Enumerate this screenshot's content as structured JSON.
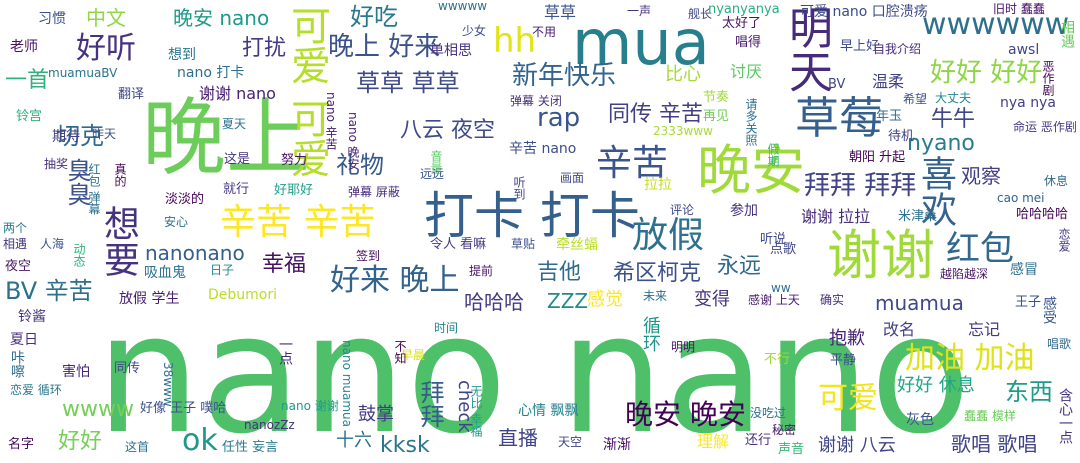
{
  "words": [
    {
      "text": "nano nano",
      "color": "#4fc06a"
    },
    {
      "text": "晚上",
      "color": "#6ccd5a"
    },
    {
      "text": "mua",
      "color": "#277f8e"
    },
    {
      "text": "谢谢",
      "color": "#a0da39"
    },
    {
      "text": "晚安",
      "color": "#a0da39"
    },
    {
      "text": "打卡 打卡",
      "color": "#355f8d"
    },
    {
      "text": "明天",
      "color": "#472a7a"
    },
    {
      "text": "草莓",
      "color": "#355f8d"
    },
    {
      "text": "可爱 可爱",
      "color": "#b5de2b"
    },
    {
      "text": "辛苦 辛苦",
      "color": "#fde725"
    },
    {
      "text": "放假",
      "color": "#2c728e"
    },
    {
      "text": "辛苦",
      "color": "#3a548c"
    },
    {
      "text": "想要",
      "color": "#46337f"
    },
    {
      "text": "喜欢",
      "color": "#33638d"
    },
    {
      "text": "红包",
      "color": "#31688e"
    },
    {
      "text": "好听",
      "color": "#46327e"
    },
    {
      "text": "wwwwww",
      "color": "#2e6f8e"
    },
    {
      "text": "hh",
      "color": "#e2e418"
    },
    {
      "text": "新年快乐",
      "color": "#32648e"
    },
    {
      "text": "加油 加油",
      "color": "#dde318"
    },
    {
      "text": "可爱",
      "color": "#f1e51d"
    },
    {
      "text": "晚安 晚安",
      "color": "#440154"
    },
    {
      "text": "好来 晚上",
      "color": "#33638d"
    },
    {
      "text": "拜拜 拜拜",
      "color": "#414487"
    },
    {
      "text": "好好 好好",
      "color": "#8ed645"
    },
    {
      "text": "草草 草草",
      "color": "#3e4989"
    },
    {
      "text": "晚上 好来",
      "color": "#3b528b"
    },
    {
      "text": "打扰",
      "color": "#443983"
    },
    {
      "text": "好吃",
      "color": "#2a788e"
    },
    {
      "text": "中文",
      "color": "#8fd744"
    },
    {
      "text": "晚安 nano",
      "color": "#1f9a8a"
    },
    {
      "text": "一首",
      "color": "#2db27d"
    },
    {
      "text": "切克",
      "color": "#31688e"
    },
    {
      "text": "臭臭",
      "color": "#3b528b"
    },
    {
      "text": "礼物",
      "color": "#375b8d"
    },
    {
      "text": "同传 辛苦",
      "color": "#433e85"
    },
    {
      "text": "rap",
      "color": "#39568c"
    },
    {
      "text": "八云 夜空",
      "color": "#3e4a89"
    },
    {
      "text": "牛牛",
      "color": "#3f4788"
    },
    {
      "text": "nyano",
      "color": "#297b8e"
    },
    {
      "text": "BV 辛苦",
      "color": "#2d708e"
    },
    {
      "text": "吉他",
      "color": "#2f6b8e"
    },
    {
      "text": "幸福",
      "color": "#471063"
    },
    {
      "text": "nanonano",
      "color": "#355e8d"
    },
    {
      "text": "希区柯克",
      "color": "#3b528b"
    },
    {
      "text": "永远",
      "color": "#31688e"
    },
    {
      "text": "muamua",
      "color": "#3f4889"
    },
    {
      "text": "ok",
      "color": "#1f988b"
    },
    {
      "text": "wwww",
      "color": "#73d056"
    },
    {
      "text": "直播",
      "color": "#404588"
    },
    {
      "text": "拜拜",
      "color": "#365c8d"
    },
    {
      "text": "东西",
      "color": "#1e9c89"
    },
    {
      "text": "好好 休息",
      "color": "#21a685"
    },
    {
      "text": "歌唱 歌唱",
      "color": "#414487"
    },
    {
      "text": "谢谢 八云",
      "color": "#3f4788"
    },
    {
      "text": "kksk",
      "color": "#2a768e"
    },
    {
      "text": "鼓掌",
      "color": "#443983"
    },
    {
      "text": "十六",
      "color": "#2c718e"
    },
    {
      "text": "好好",
      "color": "#75d054"
    },
    {
      "text": "哈哈哈",
      "color": "#443a83"
    },
    {
      "text": "ZZZ",
      "color": "#238a8d"
    },
    {
      "text": "感觉",
      "color": "#fde725"
    },
    {
      "text": "变得",
      "color": "#46337f"
    },
    {
      "text": "抱歉",
      "color": "#482576"
    },
    {
      "text": "改名",
      "color": "#424086"
    },
    {
      "text": "忘记",
      "color": "#453781"
    },
    {
      "text": "循环",
      "color": "#1f958b"
    },
    {
      "text": "check",
      "color": "#414487"
    },
    {
      "text": "理解",
      "color": "#fde725"
    },
    {
      "text": "比心",
      "color": "#a5db36"
    },
    {
      "text": "讨厌",
      "color": "#5cc863"
    },
    {
      "text": "谢谢 nano",
      "color": "#482173"
    },
    {
      "text": "谢谢 拉拉",
      "color": "#472d7b"
    },
    {
      "text": "观察",
      "color": "#433d84"
    },
    {
      "text": "温柔",
      "color": "#424186"
    },
    {
      "text": "nano 打卡",
      "color": "#2d708e"
    },
    {
      "text": "草草",
      "color": "#3a548c"
    },
    {
      "text": "一声",
      "color": "#46307e"
    },
    {
      "text": "可爱 nano 口腔溃疡",
      "color": "#3e4c8a"
    },
    {
      "text": "旧时 蠢蠢",
      "color": "#471365"
    },
    {
      "text": "wwwww",
      "color": "#2e6e8e"
    },
    {
      "text": "少女",
      "color": "#3d4e8a"
    },
    {
      "text": "习惯",
      "color": "#3a538b"
    },
    {
      "text": "老师",
      "color": "#471164"
    },
    {
      "text": "想到",
      "color": "#2a788e"
    },
    {
      "text": "单相思",
      "color": "#46337f"
    },
    {
      "text": "不用",
      "color": "#482071"
    },
    {
      "text": "舰长",
      "color": "#3f4788"
    },
    {
      "text": "nyanyanya",
      "color": "#29af7f"
    },
    {
      "text": "太好了",
      "color": "#481467"
    },
    {
      "text": "唱得",
      "color": "#481a6c"
    },
    {
      "text": "早上好",
      "color": "#3e4989"
    },
    {
      "text": "自我介绍",
      "color": "#472c7a"
    },
    {
      "text": "awsl",
      "color": "#404588"
    },
    {
      "text": "相遇",
      "color": "#65cb5e"
    },
    {
      "text": "恶作剧",
      "color": "#440154"
    },
    {
      "text": "muamuaBV",
      "color": "#2c728e"
    },
    {
      "text": "翻译",
      "color": "#404588"
    },
    {
      "text": "BV",
      "color": "#3f4788"
    },
    {
      "text": "希望",
      "color": "#3d4e8a"
    },
    {
      "text": "大丈夫",
      "color": "#24878e"
    },
    {
      "text": "nya nya",
      "color": "#433e85"
    },
    {
      "text": "节奏",
      "color": "#a0da39"
    },
    {
      "text": "弹幕 关闭",
      "color": "#46307e"
    },
    {
      "text": "夏天",
      "color": "#2c738e"
    },
    {
      "text": "铃宫",
      "color": "#2eb37c"
    },
    {
      "text": "昨天",
      "color": "#3b528b"
    },
    {
      "text": "期待",
      "color": "#424186"
    },
    {
      "text": "nano 辛苦",
      "color": "#481c6e"
    },
    {
      "text": "nano 晚安",
      "color": "#482173"
    },
    {
      "text": "2333www",
      "color": "#a8db34"
    },
    {
      "text": "再见",
      "color": "#6ece58"
    },
    {
      "text": "年玉",
      "color": "#2c728e"
    },
    {
      "text": "请多关照",
      "color": "#2d708e"
    },
    {
      "text": "待机",
      "color": "#424186"
    },
    {
      "text": "命运 恶作剧",
      "color": "#443983"
    },
    {
      "text": "抽奖",
      "color": "#472f7d"
    },
    {
      "text": "这是",
      "color": "#463480"
    },
    {
      "text": "努力",
      "color": "#471365"
    },
    {
      "text": "辛苦 nano",
      "color": "#3c4f8a"
    },
    {
      "text": "音量",
      "color": "#5ac864"
    },
    {
      "text": "远远",
      "color": "#39568c"
    },
    {
      "text": "朝阳 升起",
      "color": "#440256"
    },
    {
      "text": "休息",
      "color": "#306a8e"
    },
    {
      "text": "画面",
      "color": "#3e4a89"
    },
    {
      "text": "假期",
      "color": "#35b779"
    },
    {
      "text": "红包 弹幕",
      "color": "#2c728e"
    },
    {
      "text": "真的",
      "color": "#440154"
    },
    {
      "text": "就行",
      "color": "#443983"
    },
    {
      "text": "好耶好",
      "color": "#1fa188"
    },
    {
      "text": "弹幕 屏蔽",
      "color": "#472c7a"
    },
    {
      "text": "拉拉",
      "color": "#c5e021"
    },
    {
      "text": "淡淡的",
      "color": "#440154"
    },
    {
      "text": "听到",
      "color": "#3e4989"
    },
    {
      "text": "评论",
      "color": "#3f4788"
    },
    {
      "text": "参加",
      "color": "#46327e"
    },
    {
      "text": "米津桑",
      "color": "#2c718e"
    },
    {
      "text": "cao mei",
      "color": "#33638d"
    },
    {
      "text": "哈哈哈哈",
      "color": "#440154"
    },
    {
      "text": "两个",
      "color": "#277f8e"
    },
    {
      "text": "安心",
      "color": "#2c728e"
    },
    {
      "text": "相遇",
      "color": "#453882"
    },
    {
      "text": "人海",
      "color": "#3b528b"
    },
    {
      "text": "令人 看嘛",
      "color": "#453882"
    },
    {
      "text": "草贴",
      "color": "#3b528b"
    },
    {
      "text": "牵丝蝠",
      "color": "#bddf26"
    },
    {
      "text": "听说",
      "color": "#3e4c8a"
    },
    {
      "text": "点歌",
      "color": "#3f4788"
    },
    {
      "text": "恋爱",
      "color": "#453581"
    },
    {
      "text": "越陷越深",
      "color": "#481668"
    },
    {
      "text": "动态",
      "color": "#2db27d"
    },
    {
      "text": "夜空",
      "color": "#48186a"
    },
    {
      "text": "吸血鬼",
      "color": "#2c718e"
    },
    {
      "text": "日子",
      "color": "#23888e"
    },
    {
      "text": "签到",
      "color": "#460a5d"
    },
    {
      "text": "提前",
      "color": "#471164"
    },
    {
      "text": "放假 学生",
      "color": "#482071"
    },
    {
      "text": "Debumori",
      "color": "#bade28"
    },
    {
      "text": "未来",
      "color": "#2e6e8e"
    },
    {
      "text": "ww",
      "color": "#2e6f8e"
    },
    {
      "text": "感谢 上天",
      "color": "#481b6d"
    },
    {
      "text": "确实",
      "color": "#46307e"
    },
    {
      "text": "王子",
      "color": "#3b518b"
    },
    {
      "text": "感冒",
      "color": "#2d718e"
    },
    {
      "text": "铃酱",
      "color": "#46337f"
    },
    {
      "text": "时间",
      "color": "#25848e"
    },
    {
      "text": "感受",
      "color": "#3a548c"
    },
    {
      "text": "夏日",
      "color": "#472f7d"
    },
    {
      "text": "一点",
      "color": "#472c7a"
    },
    {
      "text": "早晨",
      "color": "#d8e219"
    },
    {
      "text": "不知",
      "color": "#440154"
    },
    {
      "text": "nano muamua",
      "color": "#24868e"
    },
    {
      "text": "明明",
      "color": "#481769"
    },
    {
      "text": "咔嚓",
      "color": "#2f6c8e"
    },
    {
      "text": "害怕",
      "color": "#482878"
    },
    {
      "text": "同传",
      "color": "#3e4989"
    },
    {
      "text": "不行",
      "color": "#a0da39"
    },
    {
      "text": "平静",
      "color": "#3e4a89"
    },
    {
      "text": "唱歌",
      "color": "#306a8e"
    },
    {
      "text": "恋爱 循环",
      "color": "#2a788e"
    },
    {
      "text": "38www",
      "color": "#2c718e"
    },
    {
      "text": "无比 幸福",
      "color": "#1f9e89"
    },
    {
      "text": "好像 王子 噗哈",
      "color": "#3b528b"
    },
    {
      "text": "nano 谢谢",
      "color": "#1f9a8a"
    },
    {
      "text": "心情 飘飘",
      "color": "#25838e"
    },
    {
      "text": "没吃过",
      "color": "#2e6f8e"
    },
    {
      "text": "蠢蠢 模样",
      "color": "#6ccd5a"
    },
    {
      "text": "灰色",
      "color": "#3a548c"
    },
    {
      "text": "nanozZz",
      "color": "#46307e"
    },
    {
      "text": "秘密",
      "color": "#48196b"
    },
    {
      "text": "含心一点",
      "color": "#46337f"
    },
    {
      "text": "名字",
      "color": "#460a5d"
    },
    {
      "text": "这首",
      "color": "#2c728e"
    },
    {
      "text": "任性 妄言",
      "color": "#2a788e"
    },
    {
      "text": "天空",
      "color": "#3f4788"
    },
    {
      "text": "渐渐",
      "color": "#471164"
    },
    {
      "text": "还行",
      "color": "#46337f"
    },
    {
      "text": "声音",
      "color": "#39b977"
    }
  ]
}
